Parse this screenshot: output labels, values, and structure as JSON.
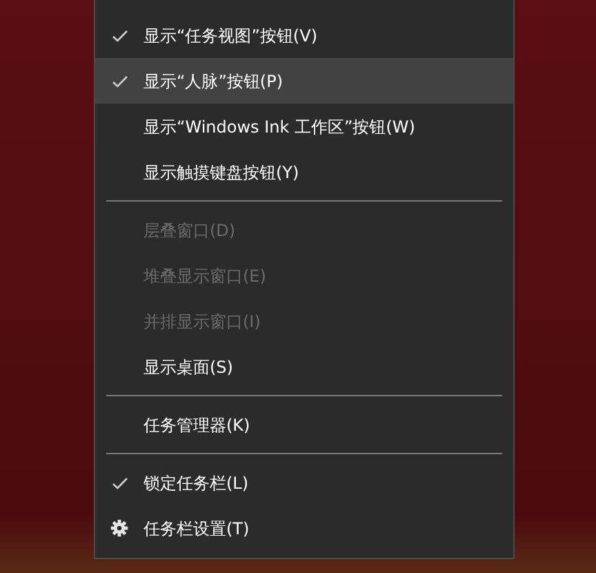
{
  "menu": {
    "items": [
      {
        "kind": "item",
        "label": "显示“任务视图”按钮(V)",
        "checked": true,
        "selected": false,
        "disabled": false
      },
      {
        "kind": "item",
        "label": "显示“人脉”按钮(P)",
        "checked": true,
        "selected": true,
        "disabled": false
      },
      {
        "kind": "item",
        "label": "显示“Windows Ink 工作区”按钮(W)",
        "checked": false,
        "selected": false,
        "disabled": false
      },
      {
        "kind": "item",
        "label": "显示触摸键盘按钮(Y)",
        "checked": false,
        "selected": false,
        "disabled": false
      },
      {
        "kind": "separator"
      },
      {
        "kind": "item",
        "label": "层叠窗口(D)",
        "checked": false,
        "selected": false,
        "disabled": true
      },
      {
        "kind": "item",
        "label": "堆叠显示窗口(E)",
        "checked": false,
        "selected": false,
        "disabled": true
      },
      {
        "kind": "item",
        "label": "并排显示窗口(I)",
        "checked": false,
        "selected": false,
        "disabled": true
      },
      {
        "kind": "item",
        "label": "显示桌面(S)",
        "checked": false,
        "selected": false,
        "disabled": false
      },
      {
        "kind": "separator"
      },
      {
        "kind": "item",
        "label": "任务管理器(K)",
        "checked": false,
        "selected": false,
        "disabled": false
      },
      {
        "kind": "separator"
      },
      {
        "kind": "item",
        "label": "锁定任务栏(L)",
        "checked": true,
        "selected": false,
        "disabled": false
      },
      {
        "kind": "settings",
        "label": "任务栏设置(T)",
        "checked": false,
        "selected": false,
        "disabled": false
      }
    ]
  }
}
